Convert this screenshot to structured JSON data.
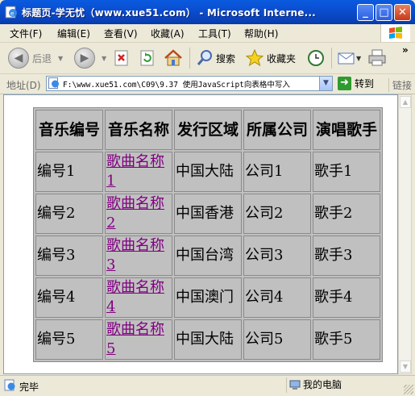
{
  "window": {
    "title": "标题页-学无忧（www.xue51.com） - Microsoft Interne...",
    "minimize_label": "_",
    "maximize_label": "□",
    "close_label": "✕"
  },
  "menu": [
    {
      "label": "文件(F)"
    },
    {
      "label": "编辑(E)"
    },
    {
      "label": "查看(V)"
    },
    {
      "label": "收藏(A)"
    },
    {
      "label": "工具(T)"
    },
    {
      "label": "帮助(H)"
    }
  ],
  "toolbar": {
    "back_label": "后退",
    "search_label": "搜索",
    "favorites_label": "收藏夹",
    "more_label": "»",
    "back_icon": "back-arrow-icon",
    "forward_icon": "forward-arrow-icon",
    "stop_icon": "stop-icon",
    "refresh_icon": "refresh-icon",
    "home_icon": "home-icon",
    "search_icon": "magnifier-icon",
    "favorites_icon": "star-icon",
    "history_icon": "history-icon",
    "mail_icon": "mail-icon",
    "print_icon": "printer-icon"
  },
  "address": {
    "label": "地址(D)",
    "url": "F:\\www.xue51.com\\C09\\9.37  使用JavaScript向表格中写入",
    "go_label": "转到",
    "links_label": "链接"
  },
  "table": {
    "headers": [
      "音乐编号",
      "音乐名称",
      "发行区域",
      "所属公司",
      "演唱歌手"
    ],
    "rows": [
      {
        "id": "编号1",
        "song": "歌曲名称1",
        "region": "中国大陆",
        "company": "公司1",
        "singer": "歌手1"
      },
      {
        "id": "编号2",
        "song": "歌曲名称2",
        "region": "中国香港",
        "company": "公司2",
        "singer": "歌手2"
      },
      {
        "id": "编号3",
        "song": "歌曲名称3",
        "region": "中国台湾",
        "company": "公司3",
        "singer": "歌手3"
      },
      {
        "id": "编号4",
        "song": "歌曲名称4",
        "region": "中国澳门",
        "company": "公司4",
        "singer": "歌手4"
      },
      {
        "id": "编号5",
        "song": "歌曲名称5",
        "region": "中国大陆",
        "company": "公司5",
        "singer": "歌手5"
      }
    ]
  },
  "status": {
    "text": "完毕",
    "zone": "我的电脑"
  },
  "colors": {
    "titlebar": "#0b4fd0",
    "link_visited": "#800080",
    "table_bg": "#c0c0c0"
  }
}
